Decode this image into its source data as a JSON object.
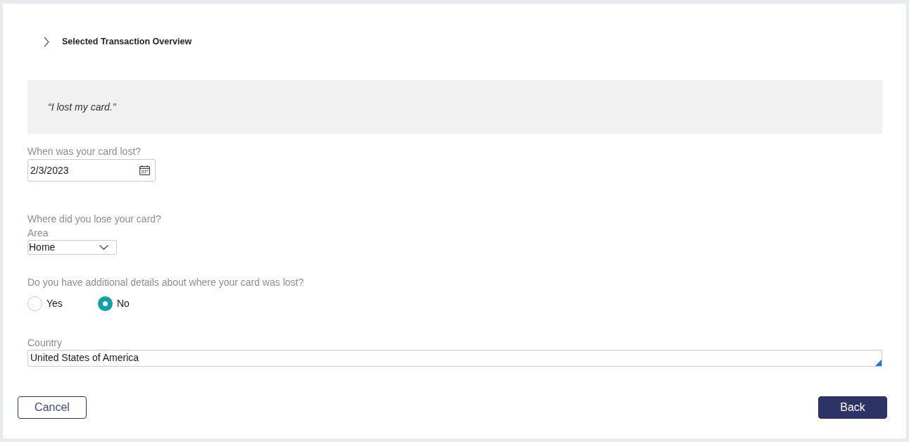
{
  "section": {
    "title": "Selected Transaction Overview",
    "expanded": false
  },
  "quote": "“I lost my card.”",
  "fields": [
    {
      "kind": "date",
      "label": "When was your card lost?",
      "value": "2/3/2023"
    },
    {
      "kind": "select",
      "label": "Where did you lose your card?",
      "sublabel": "Area",
      "value": "Home"
    },
    {
      "kind": "radio",
      "label": "Do you have additional details about where your card was lost?",
      "options": [
        {
          "label": "Yes",
          "selected": false
        },
        {
          "label": "No",
          "selected": true
        }
      ]
    },
    {
      "kind": "textarea",
      "label": "Country",
      "value": "United States of America"
    }
  ],
  "buttons": [
    {
      "label": "Cancel",
      "kind": "secondary"
    },
    {
      "label": "Back",
      "kind": "primary"
    }
  ]
}
